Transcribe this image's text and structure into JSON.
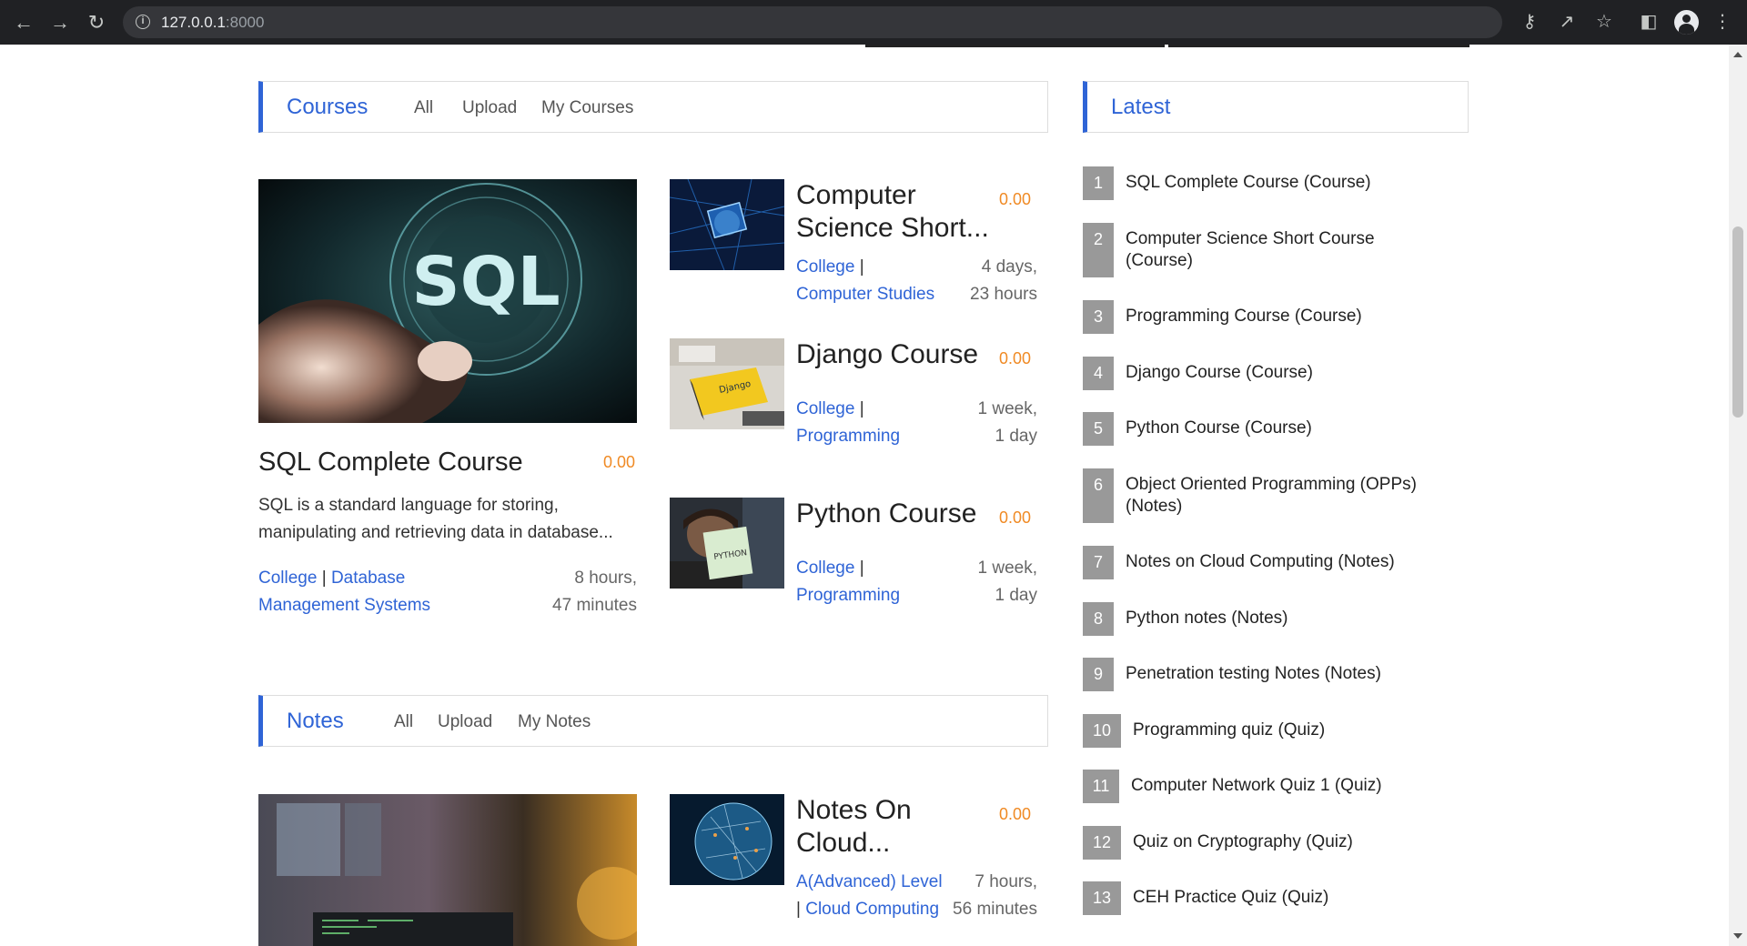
{
  "browser": {
    "url_host": "127.0.0.1",
    "url_port": ":8000"
  },
  "courses_section": {
    "title": "Courses",
    "tabs": [
      "All",
      "Upload",
      "My Courses"
    ]
  },
  "latest_section": {
    "title": "Latest"
  },
  "featured_course": {
    "title": "SQL Complete Course",
    "price": "0.00",
    "description": "SQL is a standard language for storing, manipulating and retrieving data in database...",
    "category": "College",
    "subject": "Database Management Systems",
    "duration_line1": "8 hours,",
    "duration_line2": "47 minutes",
    "thumb_text": "SQL"
  },
  "courses": [
    {
      "title": "Computer Science Short...",
      "price": "0.00",
      "category": "College",
      "subject": "Computer Studies",
      "duration_line1": "4 days,",
      "duration_line2": "23 hours"
    },
    {
      "title": "Django Course",
      "price": "0.00",
      "category": "College",
      "subject": "Programming",
      "duration_line1": "1 week,",
      "duration_line2": "1 day"
    },
    {
      "title": "Python Course",
      "price": "0.00",
      "category": "College",
      "subject": "Programming",
      "duration_line1": "1 week,",
      "duration_line2": "1 day",
      "thumb_text": "PYTHON"
    }
  ],
  "notes_section": {
    "title": "Notes",
    "tabs": [
      "All",
      "Upload",
      "My Notes"
    ]
  },
  "notes": [
    {
      "title": "Notes On Cloud...",
      "price": "0.00",
      "category": "A(Advanced) Level",
      "subject": "Cloud Computing",
      "duration_line1": "7 hours,",
      "duration_line2": "56 minutes"
    }
  ],
  "latest": [
    {
      "num": "1",
      "text": "SQL Complete Course (Course)"
    },
    {
      "num": "2",
      "text": "Computer Science Short Course (Course)"
    },
    {
      "num": "3",
      "text": "Programming Course (Course)"
    },
    {
      "num": "4",
      "text": "Django Course (Course)"
    },
    {
      "num": "5",
      "text": "Python Course (Course)"
    },
    {
      "num": "6",
      "text": "Object Oriented Programming (OPPs) (Notes)"
    },
    {
      "num": "7",
      "text": "Notes on Cloud Computing (Notes)"
    },
    {
      "num": "8",
      "text": "Python notes (Notes)"
    },
    {
      "num": "9",
      "text": "Penetration testing Notes (Notes)"
    },
    {
      "num": "10",
      "text": "Programming quiz (Quiz)"
    },
    {
      "num": "11",
      "text": "Computer Network Quiz 1 (Quiz)"
    },
    {
      "num": "12",
      "text": "Quiz on Cryptography (Quiz)"
    },
    {
      "num": "13",
      "text": "CEH Practice Quiz (Quiz)"
    }
  ],
  "colors": {
    "accent": "#2f64d6",
    "price": "#f08a24",
    "badge": "#999999"
  }
}
